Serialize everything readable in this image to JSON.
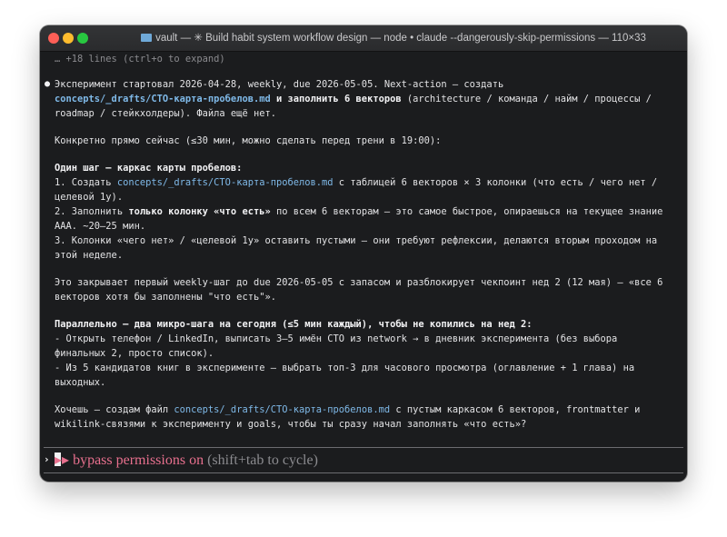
{
  "window": {
    "title": "vault — ✳ Build habit system workflow design — node • claude --dangerously-skip-permissions — 110×33"
  },
  "terminal": {
    "collapsed_hint": "… +18 lines (ctrl+o to expand)",
    "bullet_glyph": "●",
    "line1": "Эксперимент стартовал 2026-04-28, weekly, due 2026-05-05. Next-action — создать",
    "line2_path": "concepts/_drafts/CTO-карта-пробелов.md",
    "line2_bold": " и заполнить 6 векторов",
    "line2_rest": " (architecture / команда / найм / процессы /",
    "line3": "roadmap / стейкхолдеры). Файла ещё нет.",
    "line4": "Конкретно прямо сейчас (≤30 мин, можно сделать перед трени в 19:00):",
    "line5_bold": "Один шаг — каркас карты пробелов:",
    "line6_a": "1. Создать ",
    "line6_path": "concepts/_drafts/CTO-карта-пробелов.md",
    "line6_b": " с таблицей 6 векторов × 3 колонки (что есть / чего нет /",
    "line7": "целевой 1y).",
    "line8_a": "2. Заполнить ",
    "line8_bold": "только колонку «что есть»",
    "line8_b": " по всем 6 векторам — это самое быстрое, опираешься на текущее знание",
    "line9": "AAA. ~20–25 мин.",
    "line10": "3. Колонки «чего нет» / «целевой 1y» оставить пустыми — они требуют рефлексии, делаются вторым проходом на",
    "line11": "этой неделе.",
    "line12": "Это закрывает первый weekly-шаг до due 2026-05-05 с запасом и разблокирует чекпоинт нед 2 (12 мая) — «все 6",
    "line13": "векторов хотя бы заполнены \"что есть\"».",
    "line14_bold": "Параллельно — два микро-шага на сегодня (≤5 мин каждый), чтобы не копились на нед 2:",
    "line15": "- Открыть телефон / LinkedIn, выписать 3–5 имён CTO из network → в дневник эксперимента (без выбора",
    "line16": "финальных 2, просто список).",
    "line17": "- Из 5 кандидатов книг в эксперименте — выбрать топ-3 для часового просмотра (оглавление + 1 глава) на",
    "line18": "выходных.",
    "line19_a": "Хочешь — создам файл ",
    "line19_path": "concepts/_drafts/CTO-карта-пробелов.md",
    "line19_b": " с пустым каркасом 6 векторов, frontmatter и",
    "line20": "wikilink-связями к эксперименту и goals, чтобы ты сразу начал заполнять «что есть»?",
    "prompt_glyph": "›",
    "status_arrows": "▸▸",
    "status_accent": " bypass permissions on",
    "status_rest": " (shift+tab to cycle)"
  },
  "colors": {
    "background": "#1b1c1e",
    "text": "#e3e3e5",
    "path": "#7fb9e8",
    "dim": "#8b8b8f",
    "accent": "#e8708e"
  }
}
